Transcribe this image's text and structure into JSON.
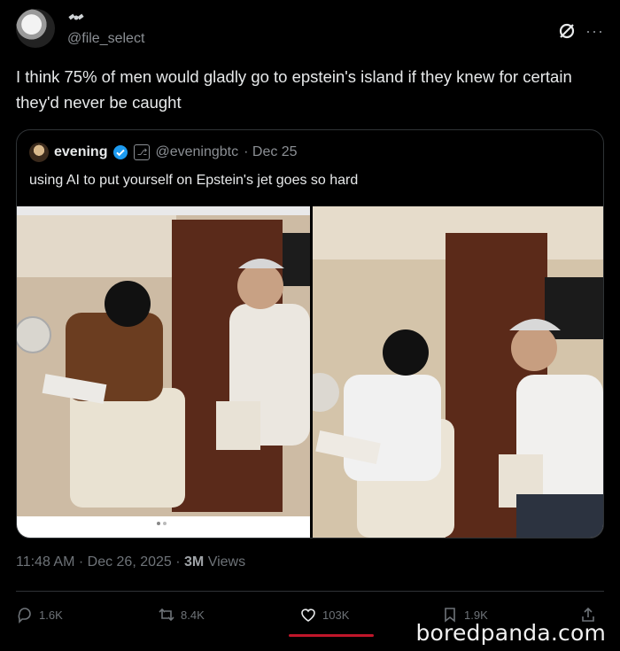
{
  "header": {
    "handle": "@file_select",
    "avatar_icon": "moon-avatar",
    "satellite_icon": "satellite-icon",
    "grok_icon": "grok-icon",
    "more_icon": "more-icon"
  },
  "post": {
    "text": "I think 75% of men would gladly go to epstein's island if they knew for certain they'd never be caught",
    "timestamp": "11:48 AM · Dec 26, 2025 · ",
    "views": "3M",
    "views_label": " Views"
  },
  "quoted": {
    "name": "evening",
    "handle": "@eveningbtc",
    "date": "· Dec 25",
    "text": "using AI to put yourself on Epstein's jet goes so hard",
    "media_count": 2
  },
  "actions": {
    "reply_count": "1.6K",
    "repost_count": "8.4K",
    "like_count": "103K",
    "bookmark_count": "1.9K"
  },
  "colors": {
    "background": "#000000",
    "text": "#e7e9ea",
    "muted": "#6e7378",
    "verified": "#1d9bf0",
    "like_underline": "#c0162a"
  },
  "watermark": "boredpanda.com"
}
